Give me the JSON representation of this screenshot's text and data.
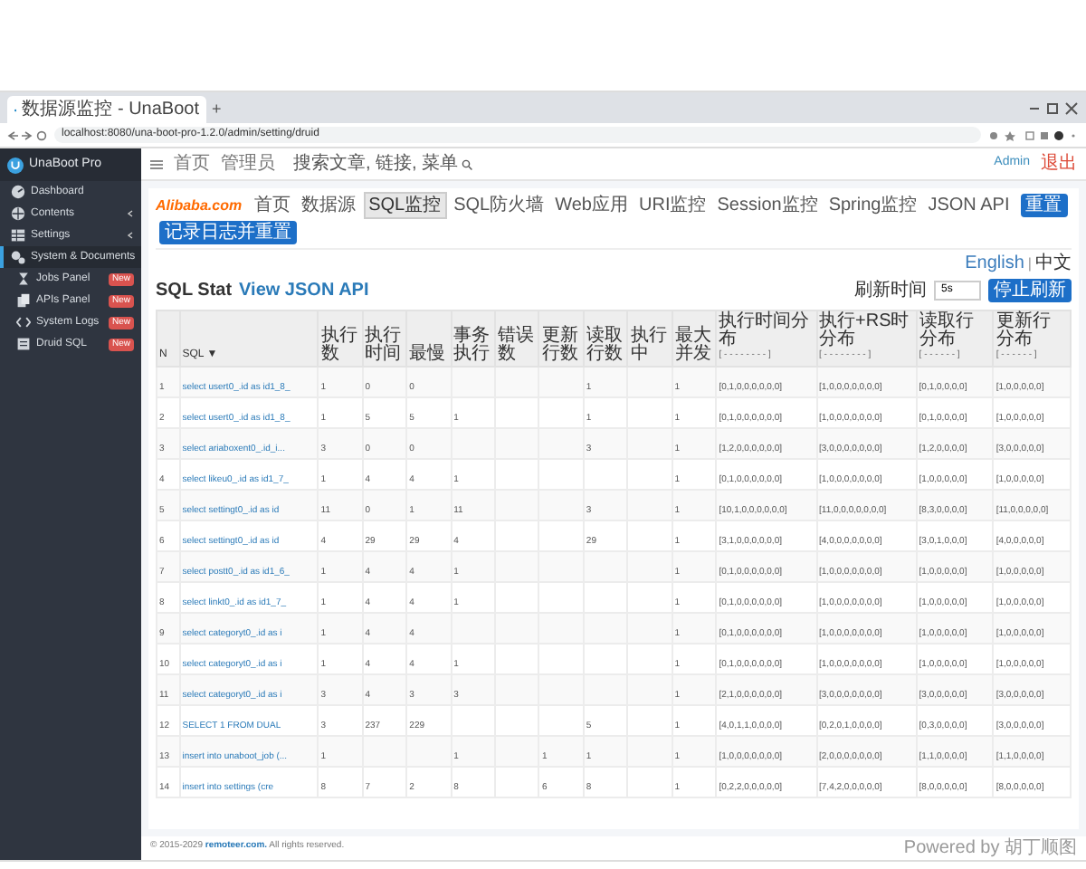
{
  "browser": {
    "tab_title": "数据源监控 - UnaBoot",
    "new_tab": "+",
    "url": "localhost:8080/una-boot-pro-1.2.0/admin/setting/druid"
  },
  "sidebar": {
    "brand": "UnaBoot Pro",
    "items": [
      {
        "label": "Dashboard",
        "kind": "dashboard",
        "selected": false
      },
      {
        "label": "Contents",
        "kind": "contents",
        "selected": false,
        "expanded": false
      },
      {
        "label": "Settings",
        "kind": "settings",
        "selected": false,
        "expanded": false
      },
      {
        "label": "System & Documents",
        "kind": "system",
        "selected": true,
        "expanded": true,
        "children": [
          {
            "label": "Jobs Panel",
            "kind": "jobs",
            "badge": "New"
          },
          {
            "label": "APIs Panel",
            "kind": "apis",
            "badge": "New"
          },
          {
            "label": "System Logs",
            "kind": "logs",
            "badge": "New"
          },
          {
            "label": "Druid SQL",
            "kind": "druid",
            "badge": "New"
          }
        ]
      }
    ]
  },
  "header": {
    "links": [
      "首页",
      "管理员"
    ],
    "search": {
      "placeholder": "搜索文章, 链接, 菜单"
    },
    "user": "Admin",
    "logout": "退出"
  },
  "druid": {
    "logo": "Alibaba.com",
    "tabs": [
      {
        "label": "首页",
        "selected": false
      },
      {
        "label": "数据源",
        "selected": false
      },
      {
        "label": "SQL监控",
        "selected": true
      },
      {
        "label": "SQL防火墙",
        "selected": false
      },
      {
        "label": "Web应用",
        "selected": false
      },
      {
        "label": "URI监控",
        "selected": false
      },
      {
        "label": "Session监控",
        "selected": false
      },
      {
        "label": "Spring监控",
        "selected": false
      },
      {
        "label": "JSON API",
        "selected": false
      }
    ],
    "buttons": [
      "重置",
      "记录日志并重置"
    ],
    "languages": [
      {
        "label": "English",
        "selected": false
      },
      {
        "label": "中文",
        "selected": true
      }
    ],
    "language_separator": "|",
    "title": "SQL Stat",
    "title_link": "View JSON API",
    "refresh_label": "刷新时间",
    "refresh_value": "5s",
    "stop_button": "停止刷新",
    "columns": [
      {
        "label": "N"
      },
      {
        "label": "SQL ▼"
      },
      {
        "label": "执行数"
      },
      {
        "label": "执行时间"
      },
      {
        "label": "最慢"
      },
      {
        "label": "事务执行"
      },
      {
        "label": "错误数"
      },
      {
        "label": "更新行数"
      },
      {
        "label": "读取行数"
      },
      {
        "label": "执行中"
      },
      {
        "label": "最大并发"
      },
      {
        "label": "执行时间分布",
        "sub": "[ - - - - - - - - ]"
      },
      {
        "label": "执行+RS时分布",
        "sub": "[ - - - - - - - - ]"
      },
      {
        "label": "读取行分布",
        "sub": "[ - - - - - - ]"
      },
      {
        "label": "更新行分布",
        "sub": "[ - - - - - - ]"
      }
    ],
    "rows": [
      [
        "1",
        "select usert0_.id as id1_8_",
        "1",
        "0",
        "0",
        "",
        "",
        "",
        "1",
        "",
        "1",
        "[0,1,0,0,0,0,0,0]",
        "[1,0,0,0,0,0,0,0]",
        "[0,1,0,0,0,0]",
        "[1,0,0,0,0,0]"
      ],
      [
        "2",
        "select usert0_.id as id1_8_",
        "1",
        "5",
        "5",
        "1",
        "",
        "",
        "1",
        "",
        "1",
        "[0,1,0,0,0,0,0,0]",
        "[1,0,0,0,0,0,0,0]",
        "[0,1,0,0,0,0]",
        "[1,0,0,0,0,0]"
      ],
      [
        "3",
        "select ariaboxent0_.id_i...",
        "3",
        "0",
        "0",
        "",
        "",
        "",
        "3",
        "",
        "1",
        "[1,2,0,0,0,0,0,0]",
        "[3,0,0,0,0,0,0,0]",
        "[1,2,0,0,0,0]",
        "[3,0,0,0,0,0]"
      ],
      [
        "4",
        "select likeu0_.id as id1_7_",
        "1",
        "4",
        "4",
        "1",
        "",
        "",
        "",
        "",
        "1",
        "[0,1,0,0,0,0,0,0]",
        "[1,0,0,0,0,0,0,0]",
        "[1,0,0,0,0,0]",
        "[1,0,0,0,0,0]"
      ],
      [
        "5",
        "select settingt0_.id as id",
        "11",
        "0",
        "1",
        "11",
        "",
        "",
        "3",
        "",
        "1",
        "[10,1,0,0,0,0,0,0]",
        "[11,0,0,0,0,0,0,0]",
        "[8,3,0,0,0,0]",
        "[11,0,0,0,0,0]"
      ],
      [
        "6",
        "select settingt0_.id as id",
        "4",
        "29",
        "29",
        "4",
        "",
        "",
        "29",
        "",
        "1",
        "[3,1,0,0,0,0,0,0]",
        "[4,0,0,0,0,0,0,0]",
        "[3,0,1,0,0,0]",
        "[4,0,0,0,0,0]"
      ],
      [
        "7",
        "select postt0_.id as id1_6_",
        "1",
        "4",
        "4",
        "1",
        "",
        "",
        "",
        "",
        "1",
        "[0,1,0,0,0,0,0,0]",
        "[1,0,0,0,0,0,0,0]",
        "[1,0,0,0,0,0]",
        "[1,0,0,0,0,0]"
      ],
      [
        "8",
        "select linkt0_.id as id1_7_",
        "1",
        "4",
        "4",
        "1",
        "",
        "",
        "",
        "",
        "1",
        "[0,1,0,0,0,0,0,0]",
        "[1,0,0,0,0,0,0,0]",
        "[1,0,0,0,0,0]",
        "[1,0,0,0,0,0]"
      ],
      [
        "9",
        "select categoryt0_.id as i",
        "1",
        "4",
        "4",
        "",
        "",
        "",
        "",
        "",
        "1",
        "[0,1,0,0,0,0,0,0]",
        "[1,0,0,0,0,0,0,0]",
        "[1,0,0,0,0,0]",
        "[1,0,0,0,0,0]"
      ],
      [
        "10",
        "select categoryt0_.id as i",
        "1",
        "4",
        "4",
        "1",
        "",
        "",
        "",
        "",
        "1",
        "[0,1,0,0,0,0,0,0]",
        "[1,0,0,0,0,0,0,0]",
        "[1,0,0,0,0,0]",
        "[1,0,0,0,0,0]"
      ],
      [
        "11",
        "select categoryt0_.id as i",
        "3",
        "4",
        "3",
        "3",
        "",
        "",
        "",
        "",
        "1",
        "[2,1,0,0,0,0,0,0]",
        "[3,0,0,0,0,0,0,0]",
        "[3,0,0,0,0,0]",
        "[3,0,0,0,0,0]"
      ],
      [
        "12",
        "SELECT 1 FROM DUAL",
        "3",
        "237",
        "229",
        "",
        "",
        "",
        "5",
        "",
        "1",
        "[4,0,1,1,0,0,0,0]",
        "[0,2,0,1,0,0,0,0]",
        "[0,3,0,0,0,0]",
        "[3,0,0,0,0,0]"
      ],
      [
        "13",
        "insert into unaboot_job (...",
        "1",
        "",
        "",
        "1",
        "",
        "1",
        "1",
        "",
        "1",
        "[1,0,0,0,0,0,0,0]",
        "[2,0,0,0,0,0,0,0]",
        "[1,1,0,0,0,0]",
        "[1,1,0,0,0,0]"
      ],
      [
        "14",
        "insert into settings (cre",
        "8",
        "7",
        "2",
        "8",
        "",
        "6",
        "8",
        "",
        "1",
        "[0,2,2,0,0,0,0,0]",
        "[7,4,2,0,0,0,0,0]",
        "[8,0,0,0,0,0]",
        "[8,0,0,0,0,0]"
      ]
    ]
  },
  "footer": {
    "copyright_prefix": "© 2015-2029 ",
    "copyright_link": "remoteer.com.",
    "copyright_suffix": " All rights reserved.",
    "powered": "Powered by 胡丁顺图"
  }
}
